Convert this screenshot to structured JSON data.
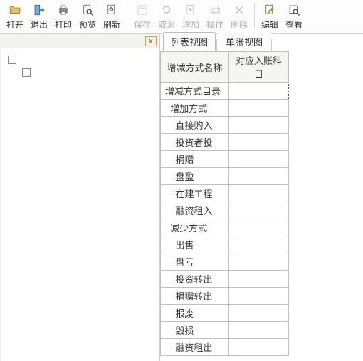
{
  "toolbar": {
    "open": {
      "label": "打开"
    },
    "exit": {
      "label": "退出"
    },
    "print": {
      "label": "打印"
    },
    "preview": {
      "label": "预览"
    },
    "refresh": {
      "label": "刷新"
    },
    "save": {
      "label": "保存"
    },
    "cancel": {
      "label": "取消"
    },
    "add": {
      "label": "增加"
    },
    "operate": {
      "label": "操作"
    },
    "delete": {
      "label": "删除"
    },
    "edit": {
      "label": "编辑"
    },
    "view": {
      "label": "查看"
    }
  },
  "left": {
    "close": "x"
  },
  "tabs": {
    "list": "列表视图",
    "form": "单张视图"
  },
  "grid": {
    "headers": {
      "name": "增减方式名称",
      "account": "对应入账科目"
    },
    "rows": [
      {
        "name": "增减方式目录",
        "indent": 0
      },
      {
        "name": "增加方式",
        "indent": 1
      },
      {
        "name": "直接购入",
        "indent": 2
      },
      {
        "name": "投资者投",
        "indent": 2
      },
      {
        "name": "捐赠",
        "indent": 2
      },
      {
        "name": "盘盈",
        "indent": 2
      },
      {
        "name": "在建工程",
        "indent": 2
      },
      {
        "name": "融资租入",
        "indent": 2
      },
      {
        "name": "减少方式",
        "indent": 1
      },
      {
        "name": "出售",
        "indent": 2
      },
      {
        "name": "盘亏",
        "indent": 2
      },
      {
        "name": "投资转出",
        "indent": 2
      },
      {
        "name": "捐赠转出",
        "indent": 2
      },
      {
        "name": "报废",
        "indent": 2
      },
      {
        "name": "毁损",
        "indent": 2
      },
      {
        "name": "融资租出",
        "indent": 2
      }
    ]
  }
}
